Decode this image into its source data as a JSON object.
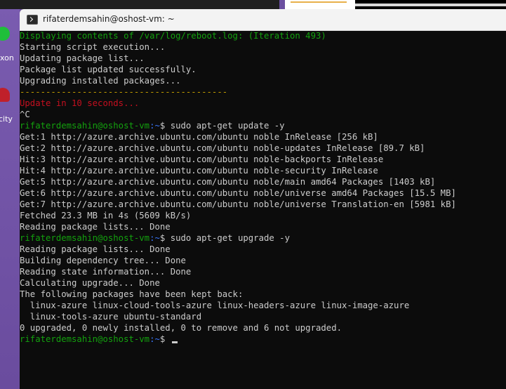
{
  "desktop": {
    "icon1_label": "xon",
    "icon1_color": "#1fbf3a",
    "icon2_label": "city",
    "icon2_color": "#c0202a"
  },
  "window": {
    "title": "rifaterdemsahin@oshost-vm: ~",
    "icon": "terminal-icon"
  },
  "terminal": {
    "lines": [
      {
        "text": "Displaying contents of /var/log/reboot.log: (Iteration 493)",
        "color": "#13a10e"
      },
      {
        "text": "Starting script execution...",
        "color": "#cccccc"
      },
      {
        "text": "Updating package list...",
        "color": "#cccccc"
      },
      {
        "text": "Package list updated successfully.",
        "color": "#cccccc"
      },
      {
        "text": "Upgrading installed packages...",
        "color": "#cccccc"
      },
      {
        "text": "----------------------------------------",
        "color": "#c19c00"
      },
      {
        "text": "Update in 10 seconds...",
        "color": "#c50f1f"
      },
      {
        "text": "^C",
        "color": "#cccccc"
      },
      {
        "prompt": "rifaterdemsahin@oshost-vm",
        "path": ":~",
        "command": "$ sudo apt-get update -y"
      },
      {
        "text": "Get:1 http://azure.archive.ubuntu.com/ubuntu noble InRelease [256 kB]",
        "color": "#cccccc"
      },
      {
        "text": "Get:2 http://azure.archive.ubuntu.com/ubuntu noble-updates InRelease [89.7 kB]",
        "color": "#cccccc"
      },
      {
        "text": "Hit:3 http://azure.archive.ubuntu.com/ubuntu noble-backports InRelease",
        "color": "#cccccc"
      },
      {
        "text": "Hit:4 http://azure.archive.ubuntu.com/ubuntu noble-security InRelease",
        "color": "#cccccc"
      },
      {
        "text": "Get:5 http://azure.archive.ubuntu.com/ubuntu noble/main amd64 Packages [1403 kB]",
        "color": "#cccccc"
      },
      {
        "text": "Get:6 http://azure.archive.ubuntu.com/ubuntu noble/universe amd64 Packages [15.5 MB]",
        "color": "#cccccc"
      },
      {
        "text": "Get:7 http://azure.archive.ubuntu.com/ubuntu noble/universe Translation-en [5981 kB]",
        "color": "#cccccc"
      },
      {
        "text": "Fetched 23.3 MB in 4s (5609 kB/s)",
        "color": "#cccccc"
      },
      {
        "text": "Reading package lists... Done",
        "color": "#cccccc"
      },
      {
        "prompt": "rifaterdemsahin@oshost-vm",
        "path": ":~",
        "command": "$ sudo apt-get upgrade -y"
      },
      {
        "text": "Reading package lists... Done",
        "color": "#cccccc"
      },
      {
        "text": "Building dependency tree... Done",
        "color": "#cccccc"
      },
      {
        "text": "Reading state information... Done",
        "color": "#cccccc"
      },
      {
        "text": "Calculating upgrade... Done",
        "color": "#cccccc"
      },
      {
        "text": "The following packages have been kept back:",
        "color": "#cccccc"
      },
      {
        "text": "  linux-azure linux-cloud-tools-azure linux-headers-azure linux-image-azure",
        "color": "#cccccc"
      },
      {
        "text": "  linux-tools-azure ubuntu-standard",
        "color": "#cccccc"
      },
      {
        "text": "0 upgraded, 0 newly installed, 0 to remove and 6 not upgraded.",
        "color": "#cccccc"
      },
      {
        "prompt": "rifaterdemsahin@oshost-vm",
        "path": ":~",
        "command": "$ "
      }
    ]
  },
  "colors": {
    "prompt_user": "#13a10e",
    "prompt_path": "#3b78ff",
    "terminal_bg": "#0c0c0c",
    "text": "#cccccc"
  }
}
